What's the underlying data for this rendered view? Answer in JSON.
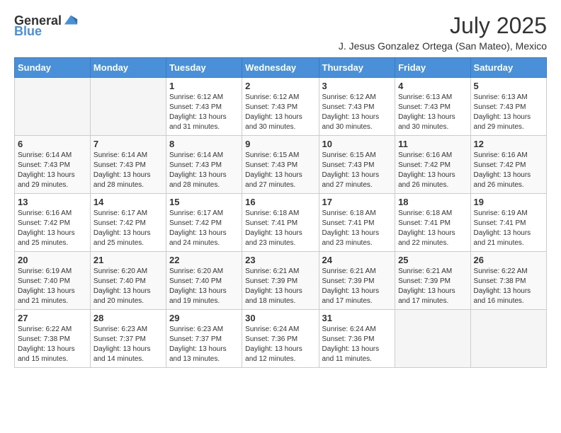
{
  "header": {
    "logo_general": "General",
    "logo_blue": "Blue",
    "month_title": "July 2025",
    "subtitle": "J. Jesus Gonzalez Ortega (San Mateo), Mexico"
  },
  "weekdays": [
    "Sunday",
    "Monday",
    "Tuesday",
    "Wednesday",
    "Thursday",
    "Friday",
    "Saturday"
  ],
  "weeks": [
    [
      {
        "day": "",
        "info": ""
      },
      {
        "day": "",
        "info": ""
      },
      {
        "day": "1",
        "info": "Sunrise: 6:12 AM\nSunset: 7:43 PM\nDaylight: 13 hours and 31 minutes."
      },
      {
        "day": "2",
        "info": "Sunrise: 6:12 AM\nSunset: 7:43 PM\nDaylight: 13 hours and 30 minutes."
      },
      {
        "day": "3",
        "info": "Sunrise: 6:12 AM\nSunset: 7:43 PM\nDaylight: 13 hours and 30 minutes."
      },
      {
        "day": "4",
        "info": "Sunrise: 6:13 AM\nSunset: 7:43 PM\nDaylight: 13 hours and 30 minutes."
      },
      {
        "day": "5",
        "info": "Sunrise: 6:13 AM\nSunset: 7:43 PM\nDaylight: 13 hours and 29 minutes."
      }
    ],
    [
      {
        "day": "6",
        "info": "Sunrise: 6:14 AM\nSunset: 7:43 PM\nDaylight: 13 hours and 29 minutes."
      },
      {
        "day": "7",
        "info": "Sunrise: 6:14 AM\nSunset: 7:43 PM\nDaylight: 13 hours and 28 minutes."
      },
      {
        "day": "8",
        "info": "Sunrise: 6:14 AM\nSunset: 7:43 PM\nDaylight: 13 hours and 28 minutes."
      },
      {
        "day": "9",
        "info": "Sunrise: 6:15 AM\nSunset: 7:43 PM\nDaylight: 13 hours and 27 minutes."
      },
      {
        "day": "10",
        "info": "Sunrise: 6:15 AM\nSunset: 7:43 PM\nDaylight: 13 hours and 27 minutes."
      },
      {
        "day": "11",
        "info": "Sunrise: 6:16 AM\nSunset: 7:42 PM\nDaylight: 13 hours and 26 minutes."
      },
      {
        "day": "12",
        "info": "Sunrise: 6:16 AM\nSunset: 7:42 PM\nDaylight: 13 hours and 26 minutes."
      }
    ],
    [
      {
        "day": "13",
        "info": "Sunrise: 6:16 AM\nSunset: 7:42 PM\nDaylight: 13 hours and 25 minutes."
      },
      {
        "day": "14",
        "info": "Sunrise: 6:17 AM\nSunset: 7:42 PM\nDaylight: 13 hours and 25 minutes."
      },
      {
        "day": "15",
        "info": "Sunrise: 6:17 AM\nSunset: 7:42 PM\nDaylight: 13 hours and 24 minutes."
      },
      {
        "day": "16",
        "info": "Sunrise: 6:18 AM\nSunset: 7:41 PM\nDaylight: 13 hours and 23 minutes."
      },
      {
        "day": "17",
        "info": "Sunrise: 6:18 AM\nSunset: 7:41 PM\nDaylight: 13 hours and 23 minutes."
      },
      {
        "day": "18",
        "info": "Sunrise: 6:18 AM\nSunset: 7:41 PM\nDaylight: 13 hours and 22 minutes."
      },
      {
        "day": "19",
        "info": "Sunrise: 6:19 AM\nSunset: 7:41 PM\nDaylight: 13 hours and 21 minutes."
      }
    ],
    [
      {
        "day": "20",
        "info": "Sunrise: 6:19 AM\nSunset: 7:40 PM\nDaylight: 13 hours and 21 minutes."
      },
      {
        "day": "21",
        "info": "Sunrise: 6:20 AM\nSunset: 7:40 PM\nDaylight: 13 hours and 20 minutes."
      },
      {
        "day": "22",
        "info": "Sunrise: 6:20 AM\nSunset: 7:40 PM\nDaylight: 13 hours and 19 minutes."
      },
      {
        "day": "23",
        "info": "Sunrise: 6:21 AM\nSunset: 7:39 PM\nDaylight: 13 hours and 18 minutes."
      },
      {
        "day": "24",
        "info": "Sunrise: 6:21 AM\nSunset: 7:39 PM\nDaylight: 13 hours and 17 minutes."
      },
      {
        "day": "25",
        "info": "Sunrise: 6:21 AM\nSunset: 7:39 PM\nDaylight: 13 hours and 17 minutes."
      },
      {
        "day": "26",
        "info": "Sunrise: 6:22 AM\nSunset: 7:38 PM\nDaylight: 13 hours and 16 minutes."
      }
    ],
    [
      {
        "day": "27",
        "info": "Sunrise: 6:22 AM\nSunset: 7:38 PM\nDaylight: 13 hours and 15 minutes."
      },
      {
        "day": "28",
        "info": "Sunrise: 6:23 AM\nSunset: 7:37 PM\nDaylight: 13 hours and 14 minutes."
      },
      {
        "day": "29",
        "info": "Sunrise: 6:23 AM\nSunset: 7:37 PM\nDaylight: 13 hours and 13 minutes."
      },
      {
        "day": "30",
        "info": "Sunrise: 6:24 AM\nSunset: 7:36 PM\nDaylight: 13 hours and 12 minutes."
      },
      {
        "day": "31",
        "info": "Sunrise: 6:24 AM\nSunset: 7:36 PM\nDaylight: 13 hours and 11 minutes."
      },
      {
        "day": "",
        "info": ""
      },
      {
        "day": "",
        "info": ""
      }
    ]
  ]
}
